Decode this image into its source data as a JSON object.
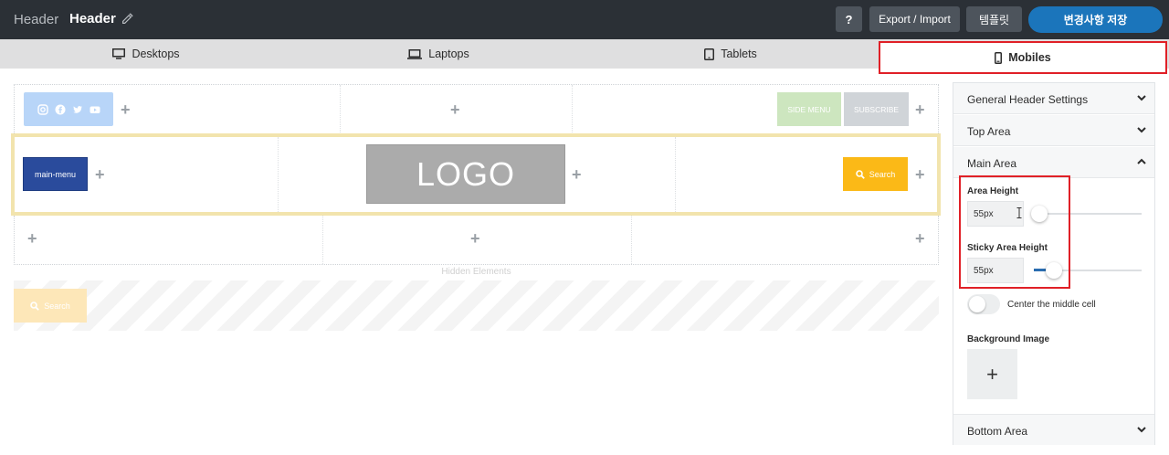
{
  "topbar": {
    "breadcrumb": "Header",
    "title": "Header",
    "help_label": "?",
    "export_label": "Export / Import",
    "template_label": "템플릿",
    "save_label": "변경사항 저장"
  },
  "device_tabs": [
    {
      "label": "Desktops",
      "icon": "desktop-icon"
    },
    {
      "label": "Laptops",
      "icon": "laptop-icon"
    },
    {
      "label": "Tablets",
      "icon": "tablet-icon"
    },
    {
      "label": "Mobiles",
      "icon": "mobile-icon",
      "active": true
    }
  ],
  "builder": {
    "top_row": {
      "social_icons": [
        "instagram-icon",
        "facebook-icon",
        "twitter-icon",
        "youtube-icon"
      ],
      "side_menu_label": "SIDE MENU",
      "subscribe_label": "SUBSCRIBE"
    },
    "main_row": {
      "menu_label": "main-menu",
      "logo_text": "LOGO",
      "search_label": "Search"
    },
    "hidden_label": "Hidden Elements",
    "hidden_search_label": "Search",
    "plus": "+"
  },
  "panel": {
    "general_label": "General Header Settings",
    "top_area_label": "Top Area",
    "main_area_label": "Main Area",
    "area_height_label": "Area Height",
    "area_height_value": "55px",
    "area_height_fraction": 0.03,
    "sticky_height_label": "Sticky Area Height",
    "sticky_height_value": "55px",
    "sticky_height_fraction": 0.1,
    "center_cell_label": "Center the middle cell",
    "center_cell_on": false,
    "bg_image_label": "Background Image",
    "bg_add": "+",
    "bottom_area_label": "Bottom Area"
  },
  "colors": {
    "topbar": "#2b3036",
    "save": "#1b75bb",
    "highlight": "#e02027",
    "search": "#fbb917",
    "menu": "#2a4b9c"
  }
}
